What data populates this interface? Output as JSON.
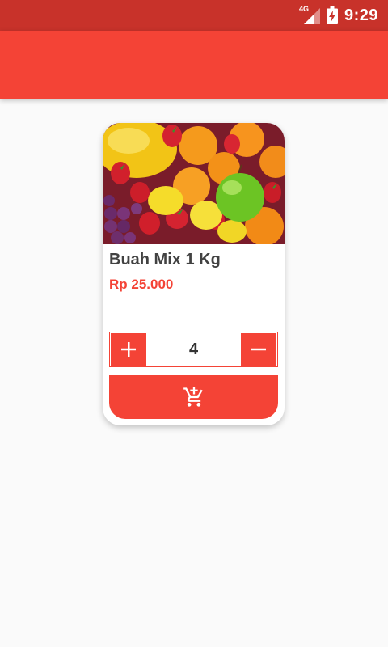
{
  "status_bar": {
    "time": "9:29",
    "network": "4G",
    "icons": [
      "signal-icon",
      "battery-charging-icon"
    ]
  },
  "product": {
    "name": "Buah Mix 1 Kg",
    "price": "Rp 25.000",
    "quantity": "4",
    "image": "mixed-fruits-photo"
  },
  "actions": {
    "increment_icon": "plus-icon",
    "decrement_icon": "minus-icon",
    "add_to_cart_icon": "add-shopping-cart-icon"
  },
  "colors": {
    "primary": "#f44336",
    "status_bar": "#c8322a",
    "background": "#fafafa",
    "text_dark": "#424242"
  }
}
